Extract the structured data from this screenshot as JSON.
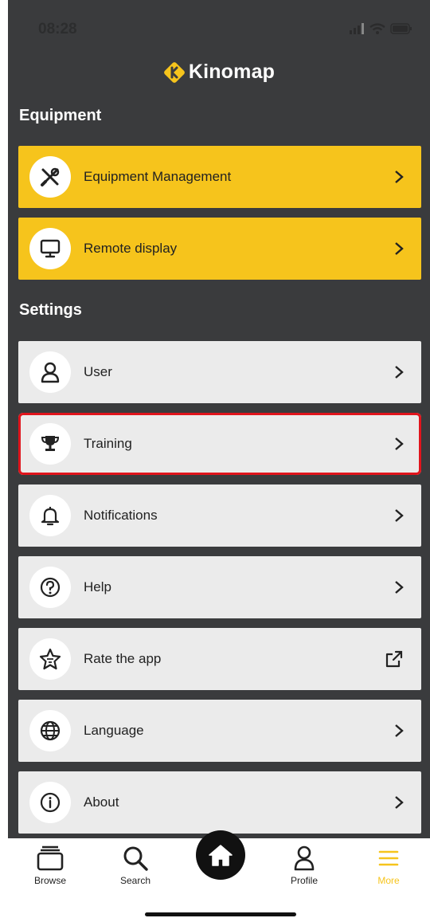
{
  "status": {
    "time": "08:28"
  },
  "brand": {
    "name": "Kinomap",
    "color": "#f6c41c"
  },
  "equipment": {
    "title": "Equipment",
    "items": [
      {
        "label": "Equipment Management",
        "icon": "tools-icon"
      },
      {
        "label": "Remote display",
        "icon": "monitor-icon"
      }
    ]
  },
  "settings": {
    "title": "Settings",
    "items": [
      {
        "label": "User",
        "icon": "user-icon"
      },
      {
        "label": "Training",
        "icon": "trophy-icon"
      },
      {
        "label": "Notifications",
        "icon": "bell-icon"
      },
      {
        "label": "Help",
        "icon": "help-circle-icon"
      },
      {
        "label": "Rate the app",
        "icon": "star-icon"
      },
      {
        "label": "Language",
        "icon": "globe-icon"
      },
      {
        "label": "About",
        "icon": "info-icon"
      }
    ]
  },
  "tabbar": {
    "browse": "Browse",
    "search": "Search",
    "profile": "Profile",
    "more": "More"
  },
  "colors": {
    "highlight": "#e0141c",
    "active_tab": "#f6c41c"
  }
}
